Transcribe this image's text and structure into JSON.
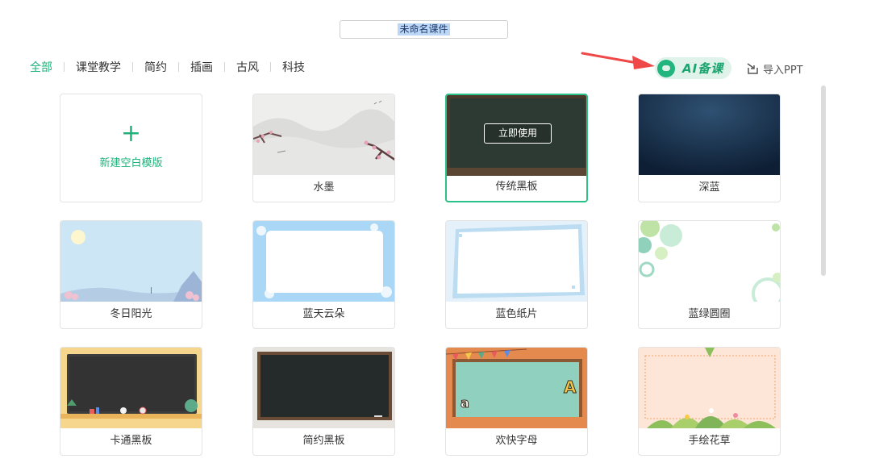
{
  "document": {
    "title_value": "未命名课件"
  },
  "categories": [
    "全部",
    "课堂教学",
    "简约",
    "插画",
    "古风",
    "科技"
  ],
  "toolbar": {
    "ai_label": "AI备课",
    "import_label": "导入PPT"
  },
  "blank": {
    "plus": "+",
    "label": "新建空白模版"
  },
  "templates": [
    {
      "name": "水墨"
    },
    {
      "name": "传统黑板",
      "hover_action": "立即使用"
    },
    {
      "name": "深蓝"
    },
    {
      "name": "冬日阳光"
    },
    {
      "name": "蓝天云朵"
    },
    {
      "name": "蓝色纸片"
    },
    {
      "name": "蓝绿圆圈"
    },
    {
      "name": "卡通黑板"
    },
    {
      "name": "简约黑板"
    },
    {
      "name": "欢快字母"
    },
    {
      "name": "手绘花草"
    }
  ],
  "colors": {
    "accent": "#1fb37b",
    "arrow": "#f04848"
  }
}
